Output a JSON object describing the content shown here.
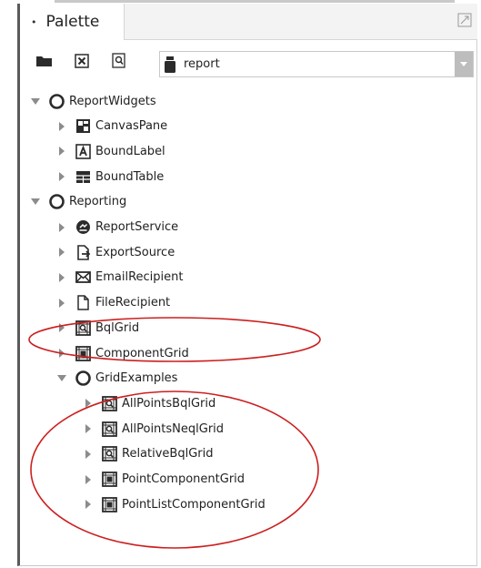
{
  "panel": {
    "tab_label": "Palette",
    "module_combo": {
      "value": "report"
    }
  },
  "tree": {
    "nodes": [
      {
        "label": "ReportWidgets",
        "icon": "folder-circle-icon",
        "level": 0,
        "expanded": true
      },
      {
        "label": "CanvasPane",
        "icon": "canvas-pane-icon",
        "level": 1,
        "expanded": false
      },
      {
        "label": "BoundLabel",
        "icon": "bound-label-icon",
        "level": 1,
        "expanded": false
      },
      {
        "label": "BoundTable",
        "icon": "bound-table-icon",
        "level": 1,
        "expanded": false
      },
      {
        "label": "Reporting",
        "icon": "folder-circle-icon",
        "level": 0,
        "expanded": true
      },
      {
        "label": "ReportService",
        "icon": "report-service-icon",
        "level": 1,
        "expanded": false
      },
      {
        "label": "ExportSource",
        "icon": "export-source-icon",
        "level": 1,
        "expanded": false
      },
      {
        "label": "EmailRecipient",
        "icon": "email-icon",
        "level": 1,
        "expanded": false
      },
      {
        "label": "FileRecipient",
        "icon": "file-icon",
        "level": 1,
        "expanded": false
      },
      {
        "label": "BqlGrid",
        "icon": "bql-grid-icon",
        "level": 1,
        "expanded": false
      },
      {
        "label": "ComponentGrid",
        "icon": "component-grid-icon",
        "level": 1,
        "expanded": false
      },
      {
        "label": "GridExamples",
        "icon": "folder-circle-icon",
        "level": 1,
        "expanded": true
      },
      {
        "label": "AllPointsBqlGrid",
        "icon": "bql-grid-icon",
        "level": 2,
        "expanded": false
      },
      {
        "label": "AllPointsNeqlGrid",
        "icon": "bql-grid-icon",
        "level": 2,
        "expanded": false
      },
      {
        "label": "RelativeBqlGrid",
        "icon": "bql-grid-icon",
        "level": 2,
        "expanded": false
      },
      {
        "label": "PointComponentGrid",
        "icon": "component-grid-icon",
        "level": 2,
        "expanded": false
      },
      {
        "label": "PointListComponentGrid",
        "icon": "component-grid-icon",
        "level": 2,
        "expanded": false
      }
    ]
  },
  "colors": {
    "annotation": "#cc1f1f",
    "icon_dark": "#2b2b2b",
    "arrow": "#8c8c8c"
  }
}
